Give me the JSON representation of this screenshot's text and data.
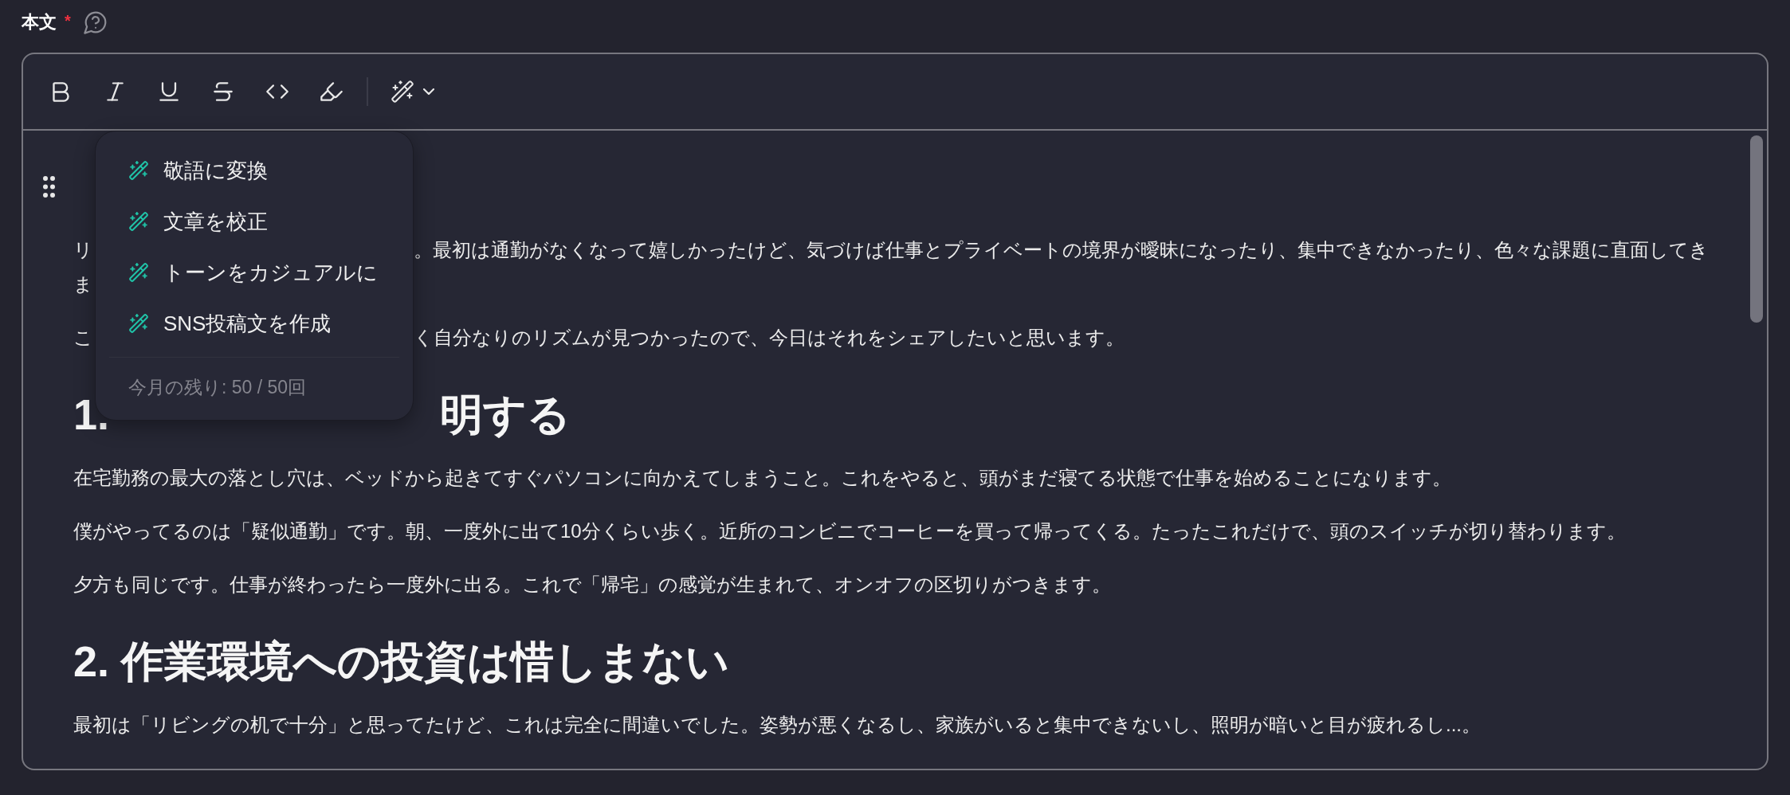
{
  "field": {
    "label": "本文",
    "required_mark": "*"
  },
  "editor": {
    "ai_menu": {
      "open": true,
      "items": [
        "敬語に変換",
        "文章を校正",
        "トーンをカジュアルに",
        "SNS投稿文を作成"
      ],
      "quota": "今月の残り: 50 / 50回"
    },
    "drag_handle": {
      "shown": true
    },
    "blocks": [
      {
        "kind": "paragraph",
        "lines": [
          [
            "リ",
            "。最初は通勤がなくなって嬉しかったけど、気づけば仕事とプライベートの境界が曖昧になったり、集中できなかったり、色々な課題に直面してき"
          ],
          [
            "ま"
          ]
        ]
      },
      {
        "kind": "paragraph",
        "lines": [
          [
            "こ",
            "く自分なりのリズムが見つかったので、今日はそれをシェアしたいと思います。"
          ]
        ]
      },
      {
        "kind": "heading",
        "lines": [
          [
            "1.",
            "明する"
          ]
        ]
      },
      {
        "kind": "paragraph",
        "text": "在宅勤務の最大の落とし穴は、ベッドから起きてすぐパソコンに向かえてしまうこと。これをやると、頭がまだ寝てる状態で仕事を始めることになります。"
      },
      {
        "kind": "paragraph",
        "text": "僕がやってるのは「疑似通勤」です。朝、一度外に出て10分くらい歩く。近所のコンビニでコーヒーを買って帰ってくる。たったこれだけで、頭のスイッチが切り替わります。"
      },
      {
        "kind": "paragraph",
        "text": "夕方も同じです。仕事が終わったら一度外に出る。これで「帰宅」の感覚が生まれて、オンオフの区切りがつきます。"
      },
      {
        "kind": "heading",
        "text": "2. 作業環境への投資は惜しまない"
      },
      {
        "kind": "paragraph",
        "text": "最初は「リビングの机で十分」と思ってたけど、これは完全に間違いでした。姿勢が悪くなるし、家族がいると集中できないし、照明が暗いと目が疲れるし...。"
      }
    ]
  }
}
